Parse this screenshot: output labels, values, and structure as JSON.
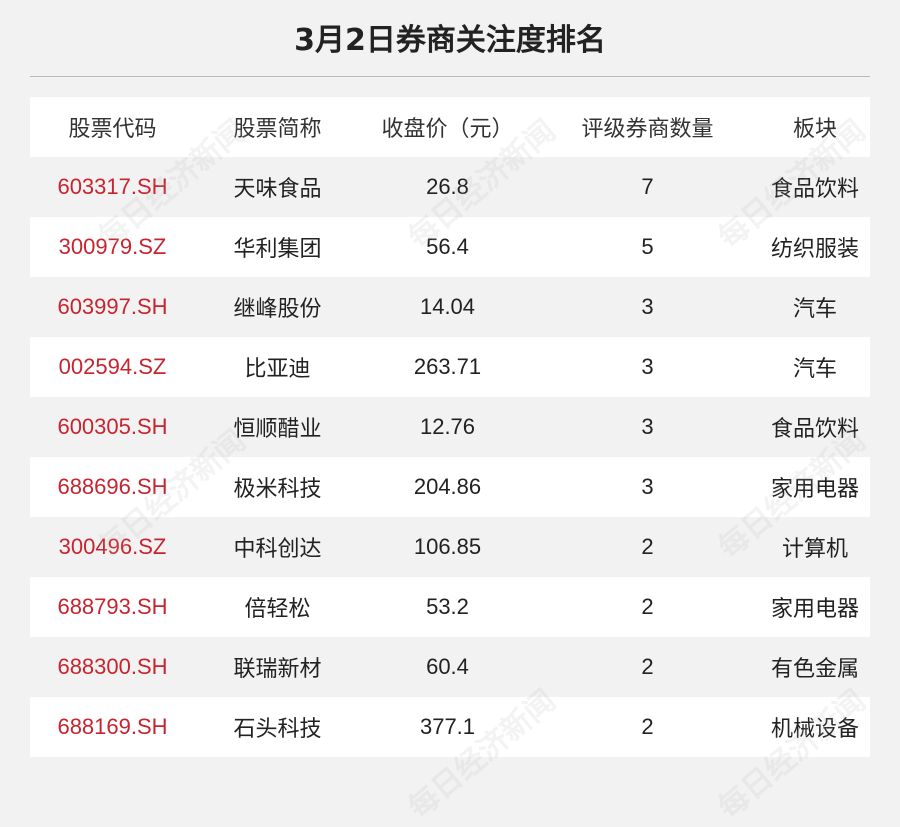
{
  "title": "3月2日券商关注度排名",
  "watermark": "每日经济新闻",
  "chart_data": {
    "type": "table",
    "title": "3月2日券商关注度排名",
    "columns": [
      "股票代码",
      "股票简称",
      "收盘价（元）",
      "评级券商数量",
      "板块"
    ],
    "rows": [
      {
        "code": "603317.SH",
        "name": "天味食品",
        "price": "26.8",
        "count": "7",
        "sector": "食品饮料"
      },
      {
        "code": "300979.SZ",
        "name": "华利集团",
        "price": "56.4",
        "count": "5",
        "sector": "纺织服装"
      },
      {
        "code": "603997.SH",
        "name": "继峰股份",
        "price": "14.04",
        "count": "3",
        "sector": "汽车"
      },
      {
        "code": "002594.SZ",
        "name": "比亚迪",
        "price": "263.71",
        "count": "3",
        "sector": "汽车"
      },
      {
        "code": "600305.SH",
        "name": "恒顺醋业",
        "price": "12.76",
        "count": "3",
        "sector": "食品饮料"
      },
      {
        "code": "688696.SH",
        "name": "极米科技",
        "price": "204.86",
        "count": "3",
        "sector": "家用电器"
      },
      {
        "code": "300496.SZ",
        "name": "中科创达",
        "price": "106.85",
        "count": "2",
        "sector": "计算机"
      },
      {
        "code": "688793.SH",
        "name": "倍轻松",
        "price": "53.2",
        "count": "2",
        "sector": "家用电器"
      },
      {
        "code": "688300.SH",
        "name": "联瑞新材",
        "price": "60.4",
        "count": "2",
        "sector": "有色金属"
      },
      {
        "code": "688169.SH",
        "name": "石头科技",
        "price": "377.1",
        "count": "2",
        "sector": "机械设备"
      }
    ]
  }
}
